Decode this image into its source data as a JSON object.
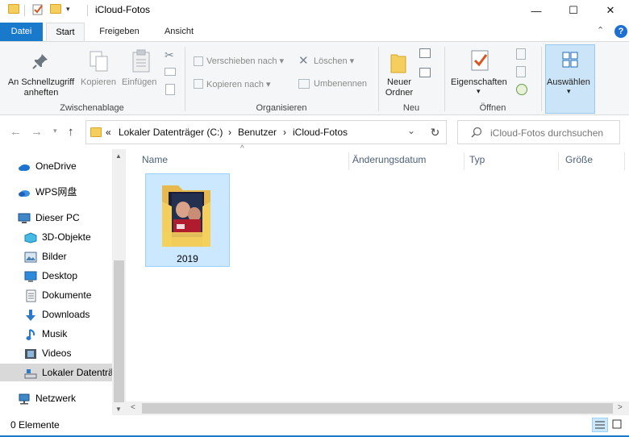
{
  "window": {
    "title": "iCloud-Fotos",
    "minimize": "—",
    "maximize": "☐",
    "close": "✕"
  },
  "tabs": [
    "Datei",
    "Start",
    "Freigeben",
    "Ansicht"
  ],
  "ribbon": {
    "pin_line1": "An Schnellzugriff",
    "pin_line2": "anheften",
    "copy": "Kopieren",
    "paste": "Einfügen",
    "move_to": "Verschieben nach",
    "copy_to": "Kopieren nach",
    "delete": "Löschen",
    "rename": "Umbenennen",
    "new_folder_line1": "Neuer",
    "new_folder_line2": "Ordner",
    "properties": "Eigenschaften",
    "select": "Auswählen",
    "groups": {
      "clipboard": "Zwischenablage",
      "organize": "Organisieren",
      "new": "Neu",
      "open": "Öffnen"
    }
  },
  "address": {
    "chevron": "«",
    "path": [
      "Lokaler Datenträger (C:)",
      "Benutzer",
      "iCloud-Fotos"
    ],
    "separator": "›",
    "search_placeholder": "iCloud-Fotos durchsuchen"
  },
  "nav_pane": {
    "items": [
      {
        "label": "OneDrive",
        "icon": "cloud-icon"
      },
      {
        "label": "WPS网盘",
        "icon": "wps-cloud-icon"
      },
      {
        "label": "Dieser PC",
        "icon": "computer-icon"
      },
      {
        "label": "3D-Objekte",
        "icon": "cube-icon"
      },
      {
        "label": "Bilder",
        "icon": "pictures-icon"
      },
      {
        "label": "Desktop",
        "icon": "desktop-icon"
      },
      {
        "label": "Dokumente",
        "icon": "documents-icon"
      },
      {
        "label": "Downloads",
        "icon": "download-icon"
      },
      {
        "label": "Musik",
        "icon": "music-icon"
      },
      {
        "label": "Videos",
        "icon": "video-icon"
      },
      {
        "label": "Lokaler Datenträ",
        "icon": "drive-icon"
      },
      {
        "label": "Netzwerk",
        "icon": "network-icon"
      }
    ]
  },
  "columns": [
    "Name",
    "Änderungsdatum",
    "Typ",
    "Größe"
  ],
  "files": [
    {
      "name": "2019"
    }
  ],
  "status": {
    "count": "0 Elemente"
  },
  "colors": {
    "accent": "#1979ca",
    "selection": "#cce8ff",
    "folder": "#f4cf5d"
  }
}
